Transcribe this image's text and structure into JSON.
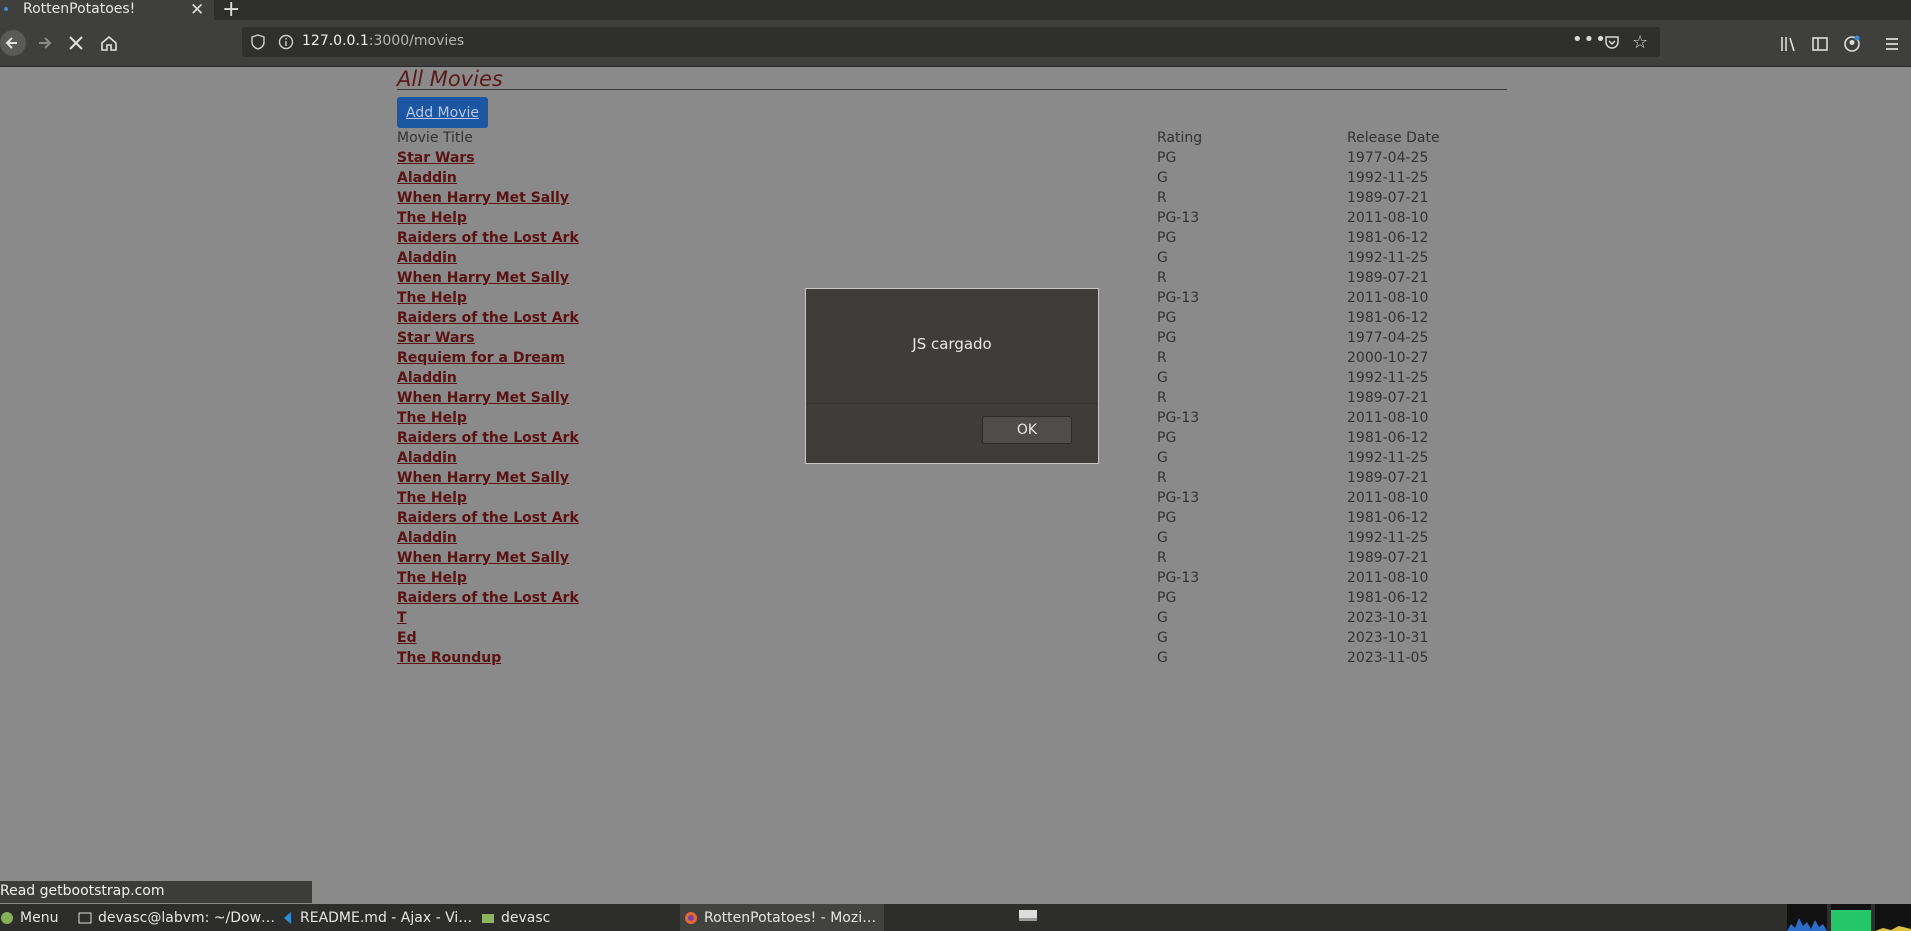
{
  "browser": {
    "tab_title": "RottenPotatoes!",
    "tab_close": "✕",
    "new_tab": "+",
    "url_host": "127.0.0.1",
    "url_path": ":3000/movies",
    "more_menu": "•••"
  },
  "page": {
    "title": "All Movies",
    "add_movie_label": "Add Movie",
    "columns": {
      "title": "Movie Title",
      "rating": "Rating",
      "release_date": "Release Date"
    },
    "movies": [
      {
        "title": "Star Wars",
        "rating": "PG",
        "date": "1977-04-25"
      },
      {
        "title": "Aladdin",
        "rating": "G",
        "date": "1992-11-25"
      },
      {
        "title": "When Harry Met Sally",
        "rating": "R",
        "date": "1989-07-21"
      },
      {
        "title": "The Help",
        "rating": "PG-13",
        "date": "2011-08-10"
      },
      {
        "title": "Raiders of the Lost Ark",
        "rating": "PG",
        "date": "1981-06-12"
      },
      {
        "title": "Aladdin",
        "rating": "G",
        "date": "1992-11-25"
      },
      {
        "title": "When Harry Met Sally",
        "rating": "R",
        "date": "1989-07-21"
      },
      {
        "title": "The Help",
        "rating": "PG-13",
        "date": "2011-08-10"
      },
      {
        "title": "Raiders of the Lost Ark",
        "rating": "PG",
        "date": "1981-06-12"
      },
      {
        "title": "Star Wars",
        "rating": "PG",
        "date": "1977-04-25"
      },
      {
        "title": "Requiem for a Dream",
        "rating": "R",
        "date": "2000-10-27"
      },
      {
        "title": "Aladdin",
        "rating": "G",
        "date": "1992-11-25"
      },
      {
        "title": "When Harry Met Sally",
        "rating": "R",
        "date": "1989-07-21"
      },
      {
        "title": "The Help",
        "rating": "PG-13",
        "date": "2011-08-10"
      },
      {
        "title": "Raiders of the Lost Ark",
        "rating": "PG",
        "date": "1981-06-12"
      },
      {
        "title": "Aladdin",
        "rating": "G",
        "date": "1992-11-25"
      },
      {
        "title": "When Harry Met Sally",
        "rating": "R",
        "date": "1989-07-21"
      },
      {
        "title": "The Help",
        "rating": "PG-13",
        "date": "2011-08-10"
      },
      {
        "title": "Raiders of the Lost Ark",
        "rating": "PG",
        "date": "1981-06-12"
      },
      {
        "title": "Aladdin",
        "rating": "G",
        "date": "1992-11-25"
      },
      {
        "title": "When Harry Met Sally",
        "rating": "R",
        "date": "1989-07-21"
      },
      {
        "title": "The Help",
        "rating": "PG-13",
        "date": "2011-08-10"
      },
      {
        "title": "Raiders of the Lost Ark",
        "rating": "PG",
        "date": "1981-06-12"
      },
      {
        "title": "T",
        "rating": "G",
        "date": "2023-10-31"
      },
      {
        "title": "Ed",
        "rating": "G",
        "date": "2023-10-31"
      },
      {
        "title": "The Roundup",
        "rating": "G",
        "date": "2023-11-05"
      }
    ]
  },
  "dialog": {
    "message": "JS cargado",
    "ok_label": "OK"
  },
  "status": {
    "text": "Read getbootstrap.com"
  },
  "taskbar": {
    "menu_label": "Menu",
    "items": [
      "devasc@labvm: ~/Dow…",
      "README.md - Ajax - Vi…",
      "devasc",
      "RottenPotatoes! - Mozi…"
    ]
  },
  "colors": {
    "link": "#5a1212",
    "button": "#1b56a3",
    "overlay_bg": "#8a8a8a",
    "dialog_bg": "#3e3d39"
  }
}
